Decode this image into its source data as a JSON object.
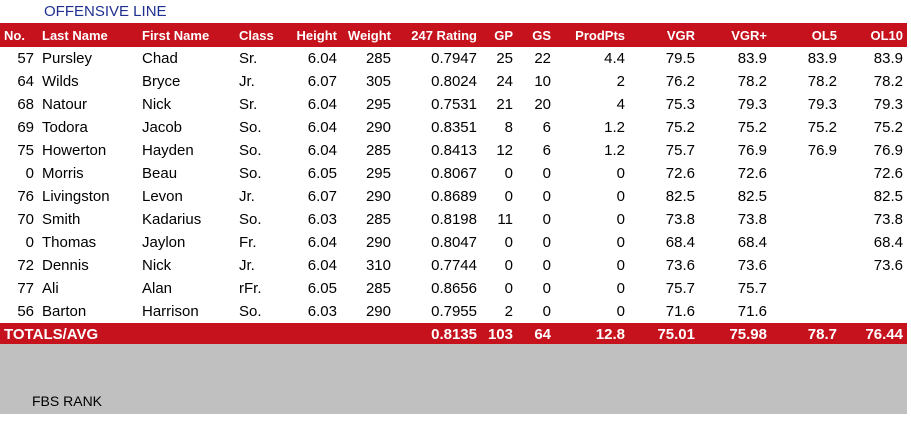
{
  "section_title": "OFFENSIVE LINE",
  "columns": [
    "No.",
    "Last Name",
    "First Name",
    "Class",
    "Height",
    "Weight",
    "247 Rating",
    "GP",
    "GS",
    "ProdPts",
    "VGR",
    "VGR+",
    "OL5",
    "OL10"
  ],
  "rows": [
    [
      "57",
      "Pursley",
      "Chad",
      "Sr.",
      "6.04",
      "285",
      "0.7947",
      "25",
      "22",
      "4.4",
      "79.5",
      "83.9",
      "83.9",
      "83.9"
    ],
    [
      "64",
      "Wilds",
      "Bryce",
      "Jr.",
      "6.07",
      "305",
      "0.8024",
      "24",
      "10",
      "2",
      "76.2",
      "78.2",
      "78.2",
      "78.2"
    ],
    [
      "68",
      "Natour",
      "Nick",
      "Sr.",
      "6.04",
      "295",
      "0.7531",
      "21",
      "20",
      "4",
      "75.3",
      "79.3",
      "79.3",
      "79.3"
    ],
    [
      "69",
      "Todora",
      "Jacob",
      "So.",
      "6.04",
      "290",
      "0.8351",
      "8",
      "6",
      "1.2",
      "75.2",
      "75.2",
      "75.2",
      "75.2"
    ],
    [
      "75",
      "Howerton",
      "Hayden",
      "So.",
      "6.04",
      "285",
      "0.8413",
      "12",
      "6",
      "1.2",
      "75.7",
      "76.9",
      "76.9",
      "76.9"
    ],
    [
      "0",
      "Morris",
      "Beau",
      "So.",
      "6.05",
      "295",
      "0.8067",
      "0",
      "0",
      "0",
      "72.6",
      "72.6",
      "",
      "72.6"
    ],
    [
      "76",
      "Livingston",
      "Levon",
      "Jr.",
      "6.07",
      "290",
      "0.8689",
      "0",
      "0",
      "0",
      "82.5",
      "82.5",
      "",
      "82.5"
    ],
    [
      "70",
      "Smith",
      "Kadarius",
      "So.",
      "6.03",
      "285",
      "0.8198",
      "11",
      "0",
      "0",
      "73.8",
      "73.8",
      "",
      "73.8"
    ],
    [
      "0",
      "Thomas",
      "Jaylon",
      "Fr.",
      "6.04",
      "290",
      "0.8047",
      "0",
      "0",
      "0",
      "68.4",
      "68.4",
      "",
      "68.4"
    ],
    [
      "72",
      "Dennis",
      "Nick",
      "Jr.",
      "6.04",
      "310",
      "0.7744",
      "0",
      "0",
      "0",
      "73.6",
      "73.6",
      "",
      "73.6"
    ],
    [
      "77",
      "Ali",
      "Alan",
      "rFr.",
      "6.05",
      "285",
      "0.8656",
      "0",
      "0",
      "0",
      "75.7",
      "75.7",
      "",
      ""
    ],
    [
      "56",
      "Barton",
      "Harrison",
      "So.",
      "6.03",
      "290",
      "0.7955",
      "2",
      "0",
      "0",
      "71.6",
      "71.6",
      "",
      ""
    ]
  ],
  "totals": {
    "label": "TOTALS/AVG",
    "values": [
      "",
      "",
      "",
      "",
      "",
      "",
      "0.8135",
      "103",
      "64",
      "12.8",
      "75.01",
      "75.98",
      "78.7",
      "76.44"
    ]
  },
  "fbs_rank_label": "FBS RANK",
  "colors": {
    "header_red": "#c5121c",
    "title_blue": "#1f2f8f",
    "band_gray": "#c0c0c0"
  }
}
